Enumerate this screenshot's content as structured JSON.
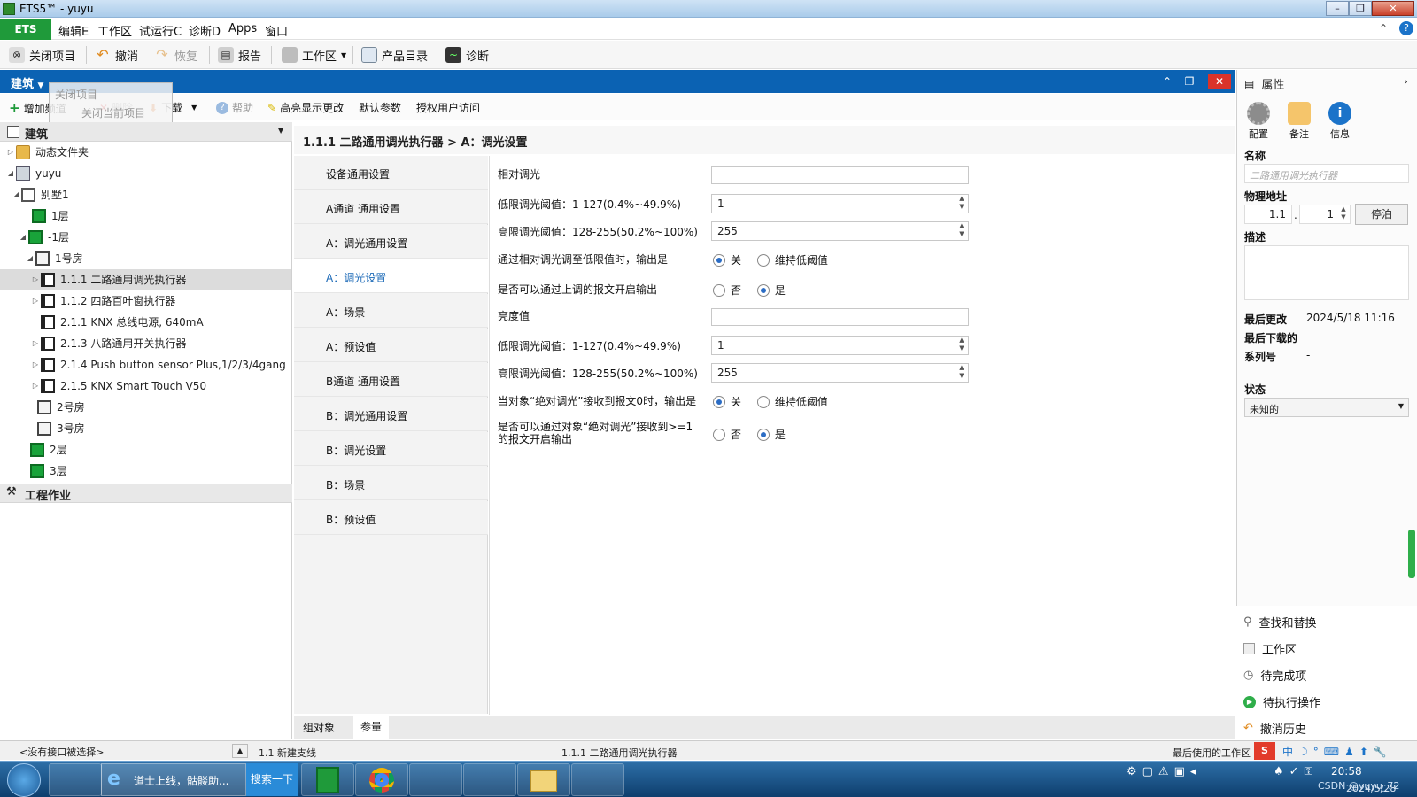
{
  "window": {
    "title": "ETS5™ - yuyu"
  },
  "menu": {
    "ets_tab": "ETS",
    "items": [
      "编辑E",
      "工作区",
      "试运行C",
      "诊断D",
      "Apps",
      "窗口"
    ]
  },
  "toolbar": {
    "close_project": "关闭项目",
    "undo": "撤消",
    "redo": "恢复",
    "report": "报告",
    "workspace": "工作区",
    "catalog": "产品目录",
    "diagnostics": "诊断"
  },
  "tooltip": {
    "line1": "关闭项目",
    "line2": "关闭当前项目"
  },
  "panel": {
    "title": "建筑"
  },
  "actions": {
    "add_channel": "增加频道",
    "delete": "删除",
    "download": "下载",
    "help": "帮助",
    "highlight": "高亮显示更改",
    "default_params": "默认参数",
    "authorize": "授权用户访问"
  },
  "tree": {
    "section_title": "建筑",
    "items": [
      {
        "label": "动态文件夹"
      },
      {
        "label": "yuyu"
      },
      {
        "label": "别墅1"
      },
      {
        "label": "1层"
      },
      {
        "label": "-1层"
      },
      {
        "label": "1号房"
      },
      {
        "label": "1.1.1 二路通用调光执行器"
      },
      {
        "label": "1.1.2 四路百叶窗执行器"
      },
      {
        "label": "2.1.1 KNX 总线电源, 640mA"
      },
      {
        "label": "2.1.3 八路通用开关执行器"
      },
      {
        "label": "2.1.4 Push button sensor Plus,1/2/3/4gang"
      },
      {
        "label": "2.1.5 KNX Smart Touch V50"
      },
      {
        "label": "2号房"
      },
      {
        "label": "3号房"
      },
      {
        "label": "2层"
      },
      {
        "label": "3层"
      }
    ],
    "section2_title": "工程作业"
  },
  "content": {
    "breadcrumb": "1.1.1 二路通用调光执行器 > A：调光设置",
    "nav": [
      "设备通用设置",
      "A通道 通用设置",
      "A：调光通用设置",
      "A：调光设置",
      "A：场景",
      "A：预设值",
      "B通道 通用设置",
      "B：调光通用设置",
      "B：调光设置",
      "B：场景",
      "B：预设值"
    ],
    "nav_active_index": 3,
    "params": {
      "relative_dim": "相对调光",
      "low_threshold_label": "低限调光阈值：1-127(0.4%~49.9%)",
      "low_threshold_value": "1",
      "high_threshold_label": "高限调光阈值：128-255(50.2%~100%)",
      "high_threshold_value": "255",
      "output_at_low_label": "通过相对调光调至低限值时，输出是",
      "output_at_low_opt1": "关",
      "output_at_low_opt2": "维持低阈值",
      "enable_up_label": "是否可以通过上调的报文开启输出",
      "no": "否",
      "yes": "是",
      "brightness": "亮度值",
      "low_threshold_value2": "1",
      "high_threshold_value2": "255",
      "abs_zero_label": "当对象“绝对调光”接收到报文0时，输出是",
      "abs_enable_label_1": "是否可以通过对象“绝对调光”接收到>=1",
      "abs_enable_label_2": "的报文开启输出"
    },
    "bottom_tabs": [
      "组对象",
      "参量"
    ]
  },
  "properties": {
    "title": "属性",
    "tabs": [
      "配置",
      "备注",
      "信息"
    ],
    "name_label": "名称",
    "name_placeholder": "二路通用调光执行器",
    "phys_addr_label": "物理地址",
    "phys_addr_prefix": "1.1",
    "phys_addr_suffix": "1",
    "park_btn": "停泊",
    "desc_label": "描述",
    "last_changed_label": "最后更改",
    "last_changed_value": "2024/5/18 11:16",
    "last_download_label": "最后下载的",
    "last_download_value": "-",
    "serial_label": "系列号",
    "serial_value": "-",
    "state_label": "状态",
    "state_value": "未知的"
  },
  "right_tools": [
    "查找和替换",
    "工作区",
    "待完成项",
    "待执行操作",
    "撤消历史"
  ],
  "statusbar": {
    "interface": "<没有接口被选择>",
    "line": "1.1 新建支线",
    "device": "1.1.1 二路通用调光执行器",
    "workspace": "最后使用的工作区"
  },
  "taskbar": {
    "ie_label": "道士上线，骷髅助...",
    "search": "搜索一下",
    "time": "20:58",
    "date": "2024/5/28",
    "watermark": "CSDN @yuyu_72"
  }
}
